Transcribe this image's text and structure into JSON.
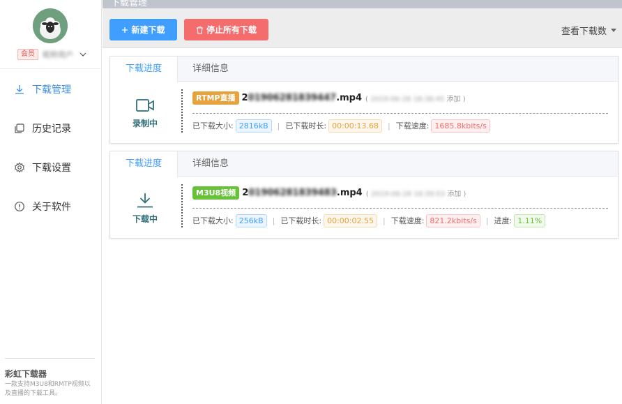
{
  "header": {
    "title": "下载管理"
  },
  "sidebar": {
    "member_badge": "会员",
    "username": "昵称用户",
    "nav": [
      {
        "label": "下载管理",
        "icon": "download-icon",
        "active": true
      },
      {
        "label": "历史记录",
        "icon": "history-icon",
        "active": false
      },
      {
        "label": "下载设置",
        "icon": "settings-icon",
        "active": false
      },
      {
        "label": "关于软件",
        "icon": "info-icon",
        "active": false
      }
    ],
    "footer": {
      "app_name": "彩虹下载器",
      "description": "一款支持M3U8和RMTP视频以及直播的下载工具。"
    }
  },
  "toolbar": {
    "new_label": "新建下载",
    "stop_label": "停止所有下载",
    "count_label": "查看下载数"
  },
  "tasks": [
    {
      "tab_progress": "下载进度",
      "tab_details": "详细信息",
      "status": "录制中",
      "status_icon": "video-camera-icon",
      "type_tag": "RTMP直播",
      "filename_prefix": "2",
      "filename_blurred": "01906281839447",
      "filename_ext": ".mp4",
      "paren_open": "(",
      "added_time": "2019-06-28 18:38:45",
      "added_label": "添加",
      "paren_close": ")",
      "size_label": "已下载大小:",
      "size_value": "2816kB",
      "duration_label": "已下载时长:",
      "duration_value": "00:00:13.68",
      "speed_label": "下载速度:",
      "speed_value": "1685.8kbits/s"
    },
    {
      "tab_progress": "下载进度",
      "tab_details": "详细信息",
      "status": "下载中",
      "status_icon": "download-arrow-icon",
      "type_tag": "M3U8视频",
      "filename_prefix": "2",
      "filename_blurred": "01906281839483",
      "filename_ext": ".mp4",
      "paren_open": "(",
      "added_time": "2019-06-28 18:39:53",
      "added_label": "添加",
      "paren_close": ")",
      "size_label": "已下载大小:",
      "size_value": "256kB",
      "duration_label": "已下载时长:",
      "duration_value": "00:00:02.55",
      "speed_label": "下载速度:",
      "speed_value": "821.2kbits/s",
      "progress_label": "进度:",
      "progress_value": "1.11%"
    }
  ],
  "colors": {
    "primary": "#409eff",
    "danger": "#f56c6c",
    "warning": "#e6a23c",
    "success": "#67c23a"
  }
}
